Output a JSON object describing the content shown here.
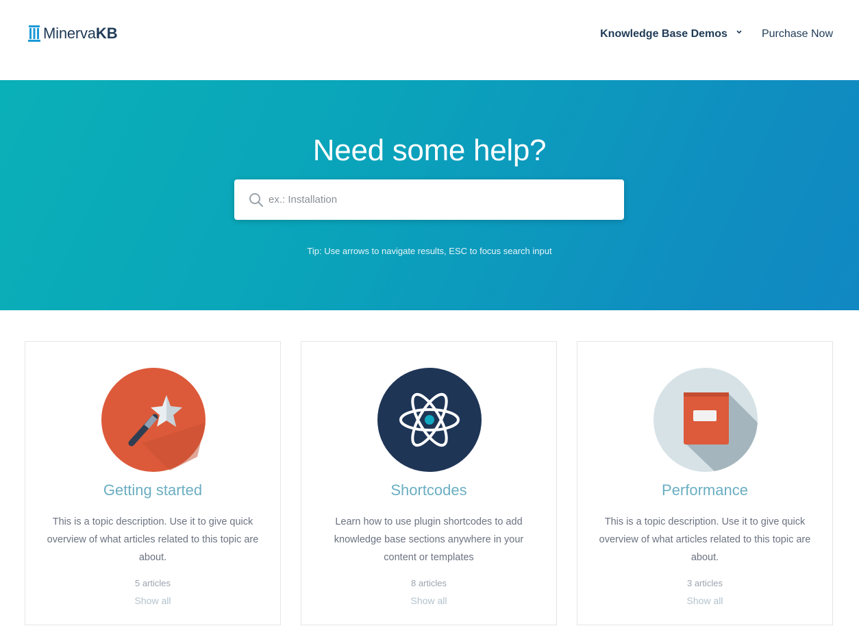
{
  "header": {
    "logo_light": "Minerva",
    "logo_bold": "KB",
    "nav": {
      "demos_label": "Knowledge Base Demos",
      "purchase_label": "Purchase Now"
    }
  },
  "hero": {
    "title": "Need some help?",
    "search_placeholder": "ex.: Installation",
    "tip": "Tip: Use arrows to navigate results, ESC to focus search input"
  },
  "topics": [
    {
      "title": "Getting started",
      "description": "This is a topic description. Use it to give quick overview of what articles related to this topic are about.",
      "count": "5 articles",
      "link": "Show all",
      "icon": "magic-wand-icon",
      "icon_bg": "#dc5a3a"
    },
    {
      "title": "Shortcodes",
      "description": "Learn how to use plugin shortcodes to add knowledge base sections anywhere in your content or templates",
      "count": "8 articles",
      "link": "Show all",
      "icon": "atom-icon",
      "icon_bg": "#1f3556"
    },
    {
      "title": "Performance",
      "description": "This is a topic description. Use it to give quick overview of what articles related to this topic are about.",
      "count": "3 articles",
      "link": "Show all",
      "icon": "book-icon",
      "icon_bg": "#d6e2e6"
    }
  ],
  "colors": {
    "brand_navy": "#1f3a56",
    "hero_start": "#0ab0b8",
    "hero_end": "#1188c2",
    "topic_title": "#6aaec2"
  }
}
